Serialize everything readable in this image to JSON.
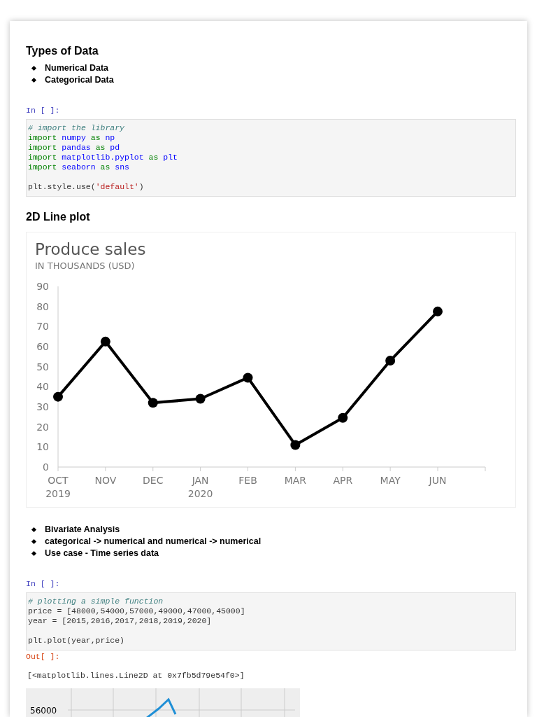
{
  "cells": [
    {
      "kind": "markdown",
      "heading": "Types of Data",
      "bullets": [
        "Numerical Data",
        "Categorical Data"
      ]
    },
    {
      "kind": "code",
      "prompt": "In [ ]:",
      "blocks": [
        [
          [
            {
              "kind": "comment",
              "text": "# import the library"
            }
          ],
          [
            {
              "kind": "keyword",
              "text": "import "
            },
            {
              "kind": "name",
              "text": "numpy "
            },
            {
              "kind": "keyword",
              "text": "as "
            },
            {
              "kind": "name",
              "text": "np"
            }
          ],
          [
            {
              "kind": "keyword",
              "text": "import "
            },
            {
              "kind": "name",
              "text": "pandas "
            },
            {
              "kind": "keyword",
              "text": "as "
            },
            {
              "kind": "name",
              "text": "pd"
            }
          ],
          [
            {
              "kind": "keyword",
              "text": "import "
            },
            {
              "kind": "name",
              "text": "matplotlib.pyplot "
            },
            {
              "kind": "keyword",
              "text": "as "
            },
            {
              "kind": "name",
              "text": "plt"
            }
          ],
          [
            {
              "kind": "keyword",
              "text": "import "
            },
            {
              "kind": "name",
              "text": "seaborn "
            },
            {
              "kind": "keyword",
              "text": "as "
            },
            {
              "kind": "name",
              "text": "sns"
            }
          ]
        ],
        [
          [
            {
              "kind": "plain",
              "text": "plt.style.use("
            },
            {
              "kind": "string",
              "text": "'default'"
            },
            {
              "kind": "plain",
              "text": ")"
            }
          ]
        ]
      ]
    },
    {
      "kind": "markdown",
      "heading": "2D Line plot"
    },
    {
      "kind": "image_chart",
      "chart_data": {
        "type": "line",
        "title": "Produce sales",
        "ylabel": "IN THOUSANDS (USD)",
        "categories": [
          "OCT 2019",
          "NOV",
          "DEC",
          "JAN 2020",
          "FEB",
          "MAR",
          "APR",
          "MAY",
          "JUN"
        ],
        "series": [
          {
            "color": "#000000",
            "marker": "o",
            "values": [
              35,
              62.5,
              32,
              34,
              44.5,
              11,
              24.5,
              53,
              77.5
            ]
          }
        ],
        "ylim": [
          0,
          90
        ],
        "yticks": [
          0,
          10,
          20,
          30,
          40,
          50,
          60,
          70,
          80,
          90
        ]
      }
    },
    {
      "kind": "markdown",
      "bullets": [
        "Bivariate Analysis",
        "categorical -> numerical and numerical -> numerical",
        "Use case - Time series data"
      ]
    },
    {
      "kind": "code",
      "prompt": "In [ ]:",
      "blocks": [
        [
          [
            {
              "kind": "comment",
              "text": "# plotting a simple function"
            }
          ],
          [
            {
              "kind": "plain",
              "text": "price = [48000,54000,57000,49000,47000,45000]"
            }
          ],
          [
            {
              "kind": "plain",
              "text": "year = [2015,2016,2017,2018,2019,2020]"
            }
          ]
        ],
        [
          [
            {
              "kind": "plain",
              "text": "plt.plot(year,price)"
            }
          ]
        ]
      ]
    },
    {
      "kind": "output",
      "prompt": "Out[ ]:",
      "text": "[<matplotlib.lines.Line2D at 0x7fb5d79e54f0>]"
    },
    {
      "kind": "plot_picture",
      "tick_label": "56000"
    }
  ]
}
